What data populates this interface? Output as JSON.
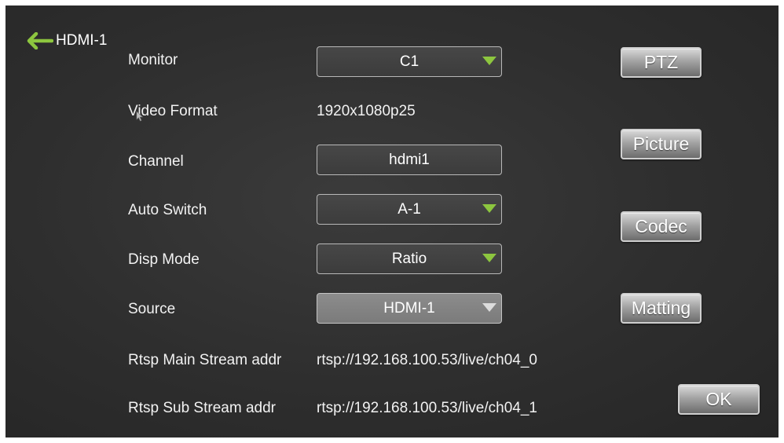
{
  "header": {
    "title": "HDMI-1",
    "back_icon": "arrow-left-icon",
    "back_icon_color": "#8dc63f"
  },
  "form": {
    "monitor": {
      "label": "Monitor",
      "value": "C1"
    },
    "video_format": {
      "label": "Video Format",
      "value": "1920x1080p25"
    },
    "channel": {
      "label": "Channel",
      "value": "hdmi1"
    },
    "auto_switch": {
      "label": "Auto Switch",
      "value": "A-1"
    },
    "disp_mode": {
      "label": "Disp Mode",
      "value": "Ratio"
    },
    "source": {
      "label": "Source",
      "value": "HDMI-1"
    },
    "rtsp_main": {
      "label": "Rtsp Main Stream addr",
      "value": "rtsp://192.168.100.53/live/ch04_0"
    },
    "rtsp_sub": {
      "label": "Rtsp Sub Stream addr",
      "value": "rtsp://192.168.100.53/live/ch04_1"
    }
  },
  "buttons": {
    "ptz": "PTZ",
    "picture": "Picture",
    "codec": "Codec",
    "matting": "Matting",
    "ok": "OK"
  },
  "colors": {
    "accent_caret": "#8dc63f",
    "panel_background": "#2e2e2e",
    "disabled_field": "#858585"
  }
}
